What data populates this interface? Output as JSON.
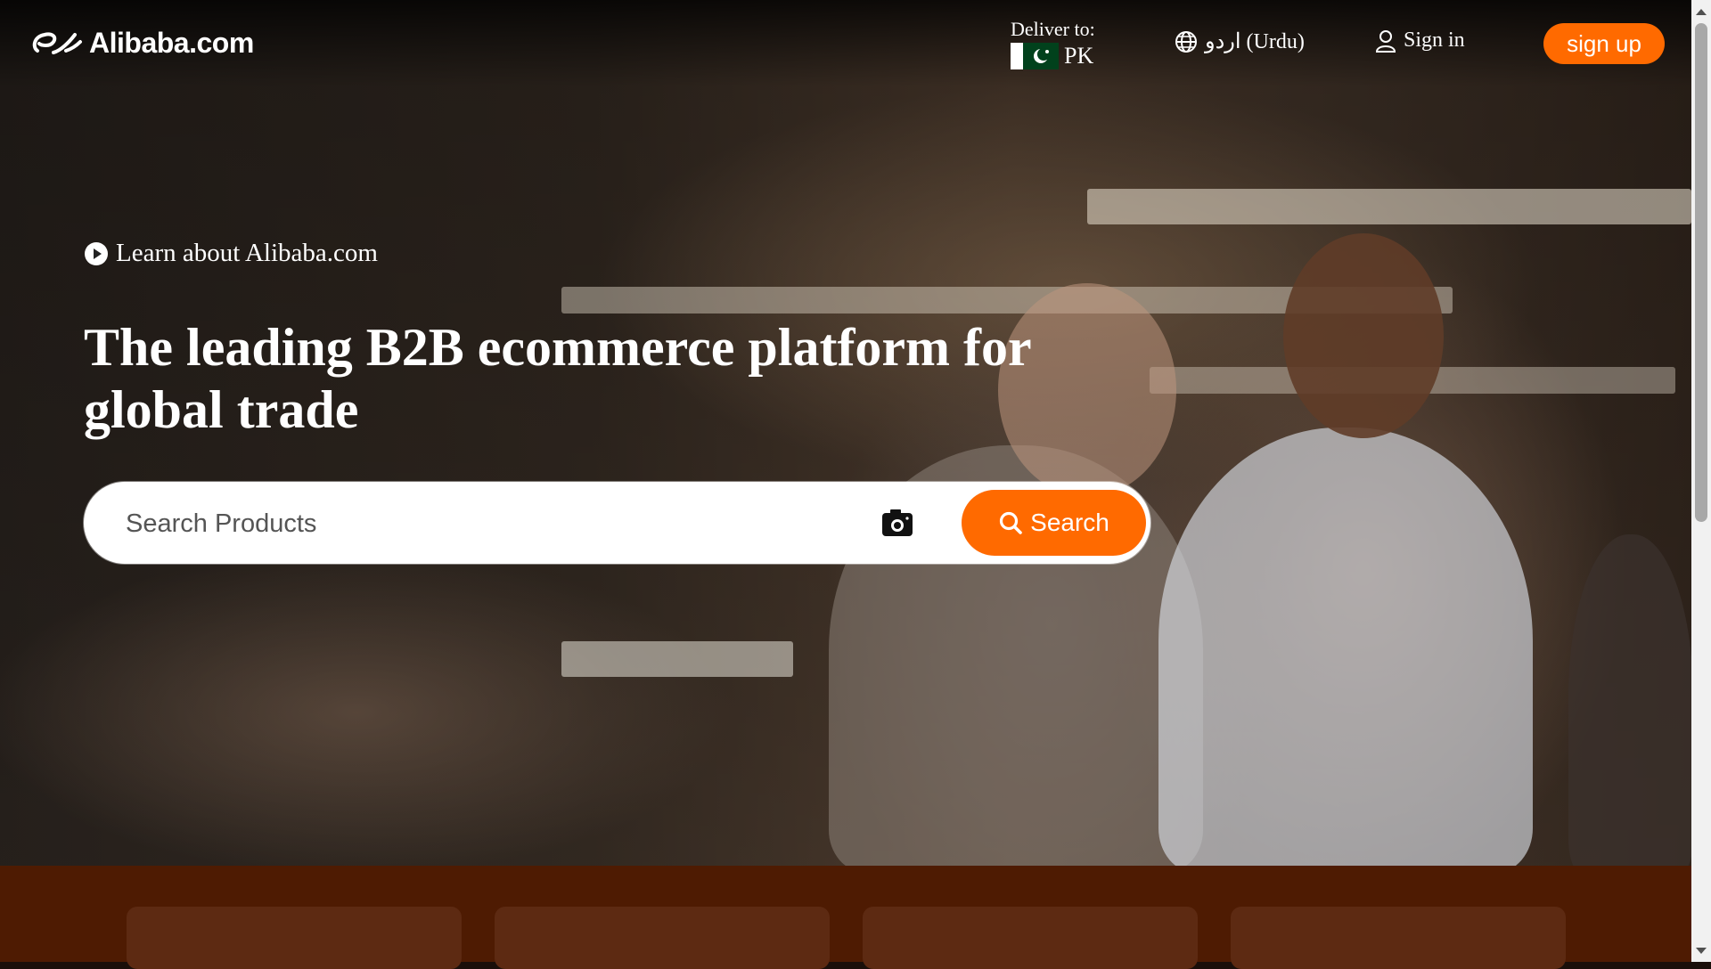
{
  "header": {
    "logo_text": "Alibaba.com",
    "deliver_label": "Deliver to:",
    "deliver_country": "PK",
    "language_label": "اردو (Urdu)",
    "signin_label": "Sign in",
    "signup_label": "sign up"
  },
  "hero": {
    "learn_label": "Learn about Alibaba.com",
    "headline": "The leading B2B ecommerce platform for global trade",
    "search": {
      "placeholder": "Search Products",
      "button_label": "Search"
    }
  },
  "icons": {
    "logo": "alibaba-logo-icon",
    "flag": "pakistan-flag-icon",
    "language": "globe-icon",
    "signin": "user-icon",
    "learn": "play-icon",
    "camera": "camera-icon",
    "search": "search-icon"
  },
  "colors": {
    "accent": "#ff6a00",
    "band": "#4e1b02",
    "card": "#5d2a12"
  }
}
